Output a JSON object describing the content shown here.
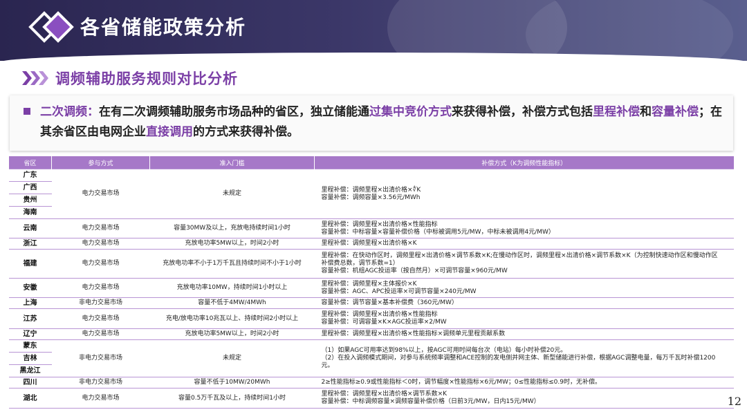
{
  "header": {
    "title": "各省储能政策分析"
  },
  "section": {
    "title": "调频辅助服务规则对比分析"
  },
  "description": {
    "parts": [
      "二次调频：",
      "在有二次调频辅助服务市场品种的省区，独立储能通",
      "过集中竞价方式",
      "来获得补偿，补偿方式包括",
      "里程补偿",
      "和",
      "容量补偿",
      "；在其余省区由电网企业",
      "直接调用",
      "的方式来获得补偿。"
    ]
  },
  "table": {
    "headers": [
      "省区",
      "参与方式",
      "准入门槛",
      "补偿方式（K为调频性能指标）"
    ],
    "rows": [
      {
        "provinces": [
          "广东",
          "广西",
          "贵州",
          "海南"
        ],
        "mode": "电力交易市场",
        "threshold": "未规定",
        "comp": [
          "里程补偿：调频里程×出清价格×∜K",
          "容量补偿：调频容量×3.56元/MWh"
        ]
      },
      {
        "provinces": [
          "云南"
        ],
        "mode": "电力交易市场",
        "threshold": "容量30MW及以上，充放电持续时间1小时",
        "comp": [
          "里程补偿：调频里程×出清价格×性能指标",
          "容量补偿：中标容量×容量补偿价格（中标被调用5元/MW，中标未被调用4元/MW）"
        ]
      },
      {
        "provinces": [
          "浙江"
        ],
        "mode": "电力交易市场",
        "threshold": "充放电功率5MW以上，时间2小时",
        "comp": [
          "里程补偿：调频里程×出清价格×K"
        ]
      },
      {
        "provinces": [
          "福建"
        ],
        "mode": "电力交易市场",
        "threshold": "充放电功率不小于1万千瓦且持续时间不小于1小时",
        "comp": [
          "里程补偿：在快动作区时，调频里程×出清价格×调节系数×K;在慢动作区时，调频里程×出清价格×调节系数×K（为控制快速动作区和慢动作区",
          "补偿费总数，调节系数=1）",
          "容量补偿：机组AGC投运率（按自然月）×可调节容量×960元/MW"
        ]
      },
      {
        "provinces": [
          "安徽"
        ],
        "mode": "电力交易市场",
        "threshold": "充放电功率10MW，持续时间1小时以上",
        "comp": [
          "里程补偿：调频里程×主体报价×K",
          "容量补偿：AGC、APC投运率×可调节容量×240元/MW"
        ]
      },
      {
        "provinces": [
          "上海"
        ],
        "mode": "非电力交易市场",
        "threshold": "容量不低于4MW/4MWh",
        "comp": [
          "容量补偿：调节容量×基本补偿费（360元/MW）"
        ]
      },
      {
        "provinces": [
          "江苏"
        ],
        "mode": "电力交易市场",
        "threshold": "充电/放电功率10兆瓦以上、持续时间2小时以上",
        "comp": [
          "里程补偿：调频里程×出清价格×性能指标",
          "容量补偿：可调容量×K×AGC投运率×2/MW"
        ]
      },
      {
        "provinces": [
          "辽宁"
        ],
        "mode": "电力交易市场",
        "threshold": "充放电功率5MW以上，时间2小时",
        "comp": [
          "里程补偿：调频里程×出清价格×性能指标×调频单元里程贡献系数"
        ]
      },
      {
        "provinces": [
          "蒙东",
          "吉林",
          "黑龙江"
        ],
        "mode": "非电力交易市场",
        "threshold": "未规定",
        "comp": [
          "（1）如果AGC可用率达到98%以上，按AGC可用时间每台次（电站）每小时补偿20元。",
          "（2）在投入调频模式期间，对参与系统频率调整和ACE控制的发电侧并网主体、新型储能进行补偿，根据AGC调整电量，每万千瓦时补偿1200",
          "元。"
        ]
      },
      {
        "provinces": [
          "四川"
        ],
        "mode": "非电力交易市场",
        "threshold": "容量不低于10MW/20MWh",
        "comp": [
          "2≥性能指标≥0.9或性能指标＜0时，调节幅度×性能指标×6元/MW；0≤性能指标≤0.9时，无补偿。"
        ]
      },
      {
        "provinces": [
          "湖北"
        ],
        "mode": "电力交易市场",
        "threshold": "容量0.5万千瓦及以上，持续时间1小时",
        "comp": [
          "里程补偿：调频里程×出清价格×调节系数×K",
          "容量补偿：中标调频容量×调频容量补偿价格（日前3元/MW，日内15元/MW）"
        ]
      }
    ]
  },
  "footer": {
    "page_number": "12"
  },
  "colors": {
    "accent": "#7b3fa6",
    "header_row": "#a678c8",
    "banner": "#3b3768"
  }
}
